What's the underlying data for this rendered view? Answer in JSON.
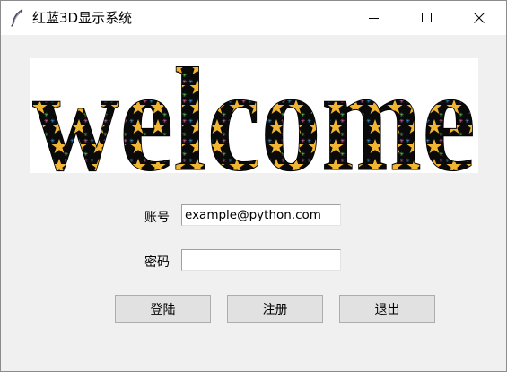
{
  "window": {
    "title": "红蓝3D显示系统",
    "icon": "feather-icon"
  },
  "titlebar_controls": {
    "minimize_icon": "minimize-icon",
    "maximize_icon": "maximize-icon",
    "close_icon": "close-icon"
  },
  "banner": {
    "text": "welcome",
    "pattern": "stars-on-black",
    "colors": {
      "letter_fill": "#0a0a0a",
      "star_gold": "#f2b531",
      "star_blue": "#3aa0e8",
      "star_green": "#6fd46b",
      "star_pink": "#e86fb8"
    }
  },
  "form": {
    "account_label": "账号",
    "account_value": "example@python.com",
    "password_label": "密码",
    "password_value": ""
  },
  "buttons": {
    "login_label": "登陆",
    "register_label": "注册",
    "exit_label": "退出"
  }
}
